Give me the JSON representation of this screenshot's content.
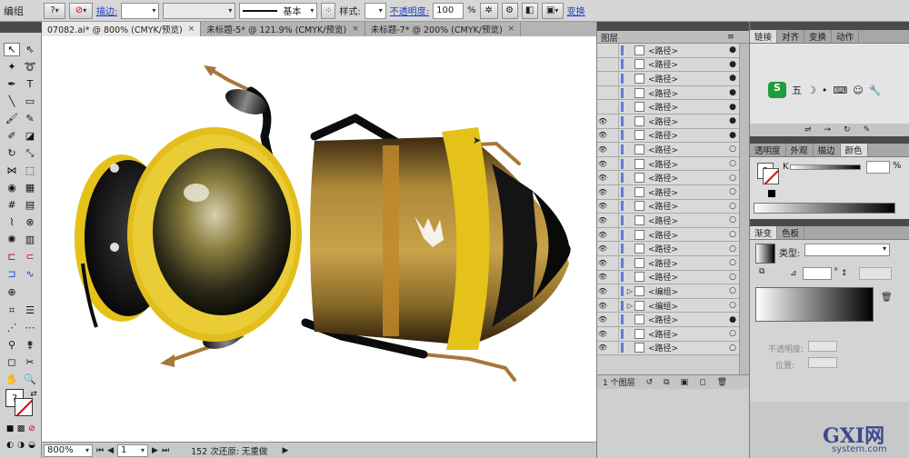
{
  "control_bar": {
    "selection_label": "编组",
    "stroke_label": "描边:",
    "stroke_value": "",
    "profile_label": "基本",
    "style_label": "样式:",
    "opacity_label": "不透明度:",
    "opacity_value": "100",
    "opacity_unit": "%",
    "transform_label": "变换"
  },
  "tabs": [
    {
      "label": "07082.ai* @ 800% (CMYK/预览)",
      "close": "×"
    },
    {
      "label": "未标题-5* @ 121.9% (CMYK/预览)",
      "close": "×"
    },
    {
      "label": "未标题-7* @ 200% (CMYK/预览)",
      "close": "×"
    }
  ],
  "status_bar": {
    "zoom": "800%",
    "page": "1",
    "history": "152 次还原: 无重做"
  },
  "layers_panel": {
    "title": "图层",
    "rows": [
      {
        "name": "<路径>",
        "visible": false,
        "filled_target": true
      },
      {
        "name": "<路径>",
        "visible": false,
        "filled_target": true
      },
      {
        "name": "<路径>",
        "visible": false,
        "filled_target": true
      },
      {
        "name": "<路径>",
        "visible": false,
        "filled_target": true
      },
      {
        "name": "<路径>",
        "visible": false,
        "filled_target": true
      },
      {
        "name": "<路径>",
        "visible": true,
        "filled_target": true
      },
      {
        "name": "<路径>",
        "visible": true,
        "filled_target": true
      },
      {
        "name": "<路径>",
        "visible": true,
        "filled_target": false
      },
      {
        "name": "<路径>",
        "visible": true,
        "filled_target": false
      },
      {
        "name": "<路径>",
        "visible": true,
        "filled_target": false
      },
      {
        "name": "<路径>",
        "visible": true,
        "filled_target": false
      },
      {
        "name": "<路径>",
        "visible": true,
        "filled_target": false
      },
      {
        "name": "<路径>",
        "visible": true,
        "filled_target": false
      },
      {
        "name": "<路径>",
        "visible": true,
        "filled_target": false
      },
      {
        "name": "<路径>",
        "visible": true,
        "filled_target": false
      },
      {
        "name": "<路径>",
        "visible": true,
        "filled_target": false
      },
      {
        "name": "<路径>",
        "visible": true,
        "filled_target": false
      },
      {
        "name": "<编组>",
        "visible": true,
        "filled_target": false
      },
      {
        "name": "<编组>",
        "visible": true,
        "filled_target": false
      },
      {
        "name": "<路径>",
        "visible": true,
        "filled_target": true
      },
      {
        "name": "<路径>",
        "visible": true,
        "filled_target": false
      },
      {
        "name": "<路径>",
        "visible": true,
        "filled_target": false
      }
    ],
    "footer": "1 个图层"
  },
  "right_panels": {
    "top_tabs": [
      "链接",
      "对齐",
      "变换",
      "动作"
    ],
    "ime_label": "五",
    "color_tabs": [
      "透明度",
      "外观",
      "描边",
      "颜色"
    ],
    "k_label": "K",
    "k_unit": "%",
    "gradient_tabs": [
      "渐变",
      "色板"
    ],
    "type_label": "类型:",
    "angle_unit": "°",
    "opacity_label": "不透明度:",
    "position_label": "位置:"
  },
  "colors": {
    "accent_link": "#1a3fc0",
    "bee_yellow": "#e4c21a",
    "bee_brown": "#a8762a",
    "bee_dark": "#1a1a1a",
    "leg_brown": "#c9823a"
  },
  "watermark": {
    "logo": "GXI网",
    "url": "system.com"
  }
}
